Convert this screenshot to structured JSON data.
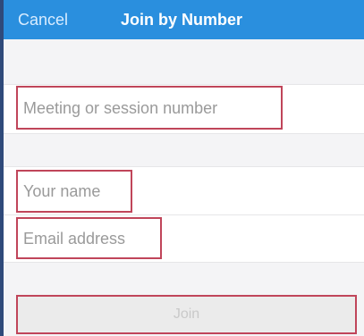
{
  "nav": {
    "cancel_label": "Cancel",
    "title": "Join by Number"
  },
  "form": {
    "meeting_number_placeholder": "Meeting or session number",
    "name_placeholder": "Your name",
    "email_placeholder": "Email address"
  },
  "join": {
    "label": "Join"
  },
  "colors": {
    "nav_background": "#2a8fde",
    "highlight_border": "#c0455a",
    "placeholder_text": "#9a9a9a"
  }
}
